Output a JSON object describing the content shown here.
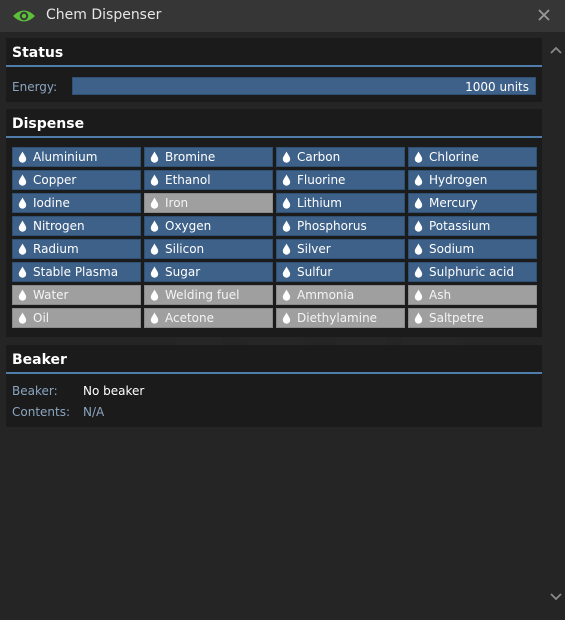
{
  "window": {
    "title": "Chem Dispenser",
    "icon": "eye-icon",
    "close_icon": "close-icon"
  },
  "status": {
    "title": "Status",
    "energy_label": "Energy:",
    "energy_text": "1000 units",
    "energy_fraction": 1.0
  },
  "dispense": {
    "title": "Dispense",
    "chemicals": [
      {
        "label": "Aluminium",
        "enabled": true
      },
      {
        "label": "Bromine",
        "enabled": true
      },
      {
        "label": "Carbon",
        "enabled": true
      },
      {
        "label": "Chlorine",
        "enabled": true
      },
      {
        "label": "Copper",
        "enabled": true
      },
      {
        "label": "Ethanol",
        "enabled": true
      },
      {
        "label": "Fluorine",
        "enabled": true
      },
      {
        "label": "Hydrogen",
        "enabled": true
      },
      {
        "label": "Iodine",
        "enabled": true
      },
      {
        "label": "Iron",
        "enabled": false
      },
      {
        "label": "Lithium",
        "enabled": true
      },
      {
        "label": "Mercury",
        "enabled": true
      },
      {
        "label": "Nitrogen",
        "enabled": true
      },
      {
        "label": "Oxygen",
        "enabled": true
      },
      {
        "label": "Phosphorus",
        "enabled": true
      },
      {
        "label": "Potassium",
        "enabled": true
      },
      {
        "label": "Radium",
        "enabled": true
      },
      {
        "label": "Silicon",
        "enabled": true
      },
      {
        "label": "Silver",
        "enabled": true
      },
      {
        "label": "Sodium",
        "enabled": true
      },
      {
        "label": "Stable Plasma",
        "enabled": true
      },
      {
        "label": "Sugar",
        "enabled": true
      },
      {
        "label": "Sulfur",
        "enabled": true
      },
      {
        "label": "Sulphuric acid",
        "enabled": true
      },
      {
        "label": "Water",
        "enabled": false
      },
      {
        "label": "Welding fuel",
        "enabled": false
      },
      {
        "label": "Ammonia",
        "enabled": false
      },
      {
        "label": "Ash",
        "enabled": false
      },
      {
        "label": "Oil",
        "enabled": false
      },
      {
        "label": "Acetone",
        "enabled": false
      },
      {
        "label": "Diethylamine",
        "enabled": false
      },
      {
        "label": "Saltpetre",
        "enabled": false
      }
    ]
  },
  "beaker": {
    "title": "Beaker",
    "beaker_label": "Beaker:",
    "beaker_value": "No beaker",
    "contents_label": "Contents:",
    "contents_value": "N/A"
  },
  "colors": {
    "accent": "#4f7cab",
    "button": "#3e6189",
    "button_disabled": "#9f9f9f",
    "label": "#8ba5c0",
    "eye": "#5bbf3a"
  }
}
